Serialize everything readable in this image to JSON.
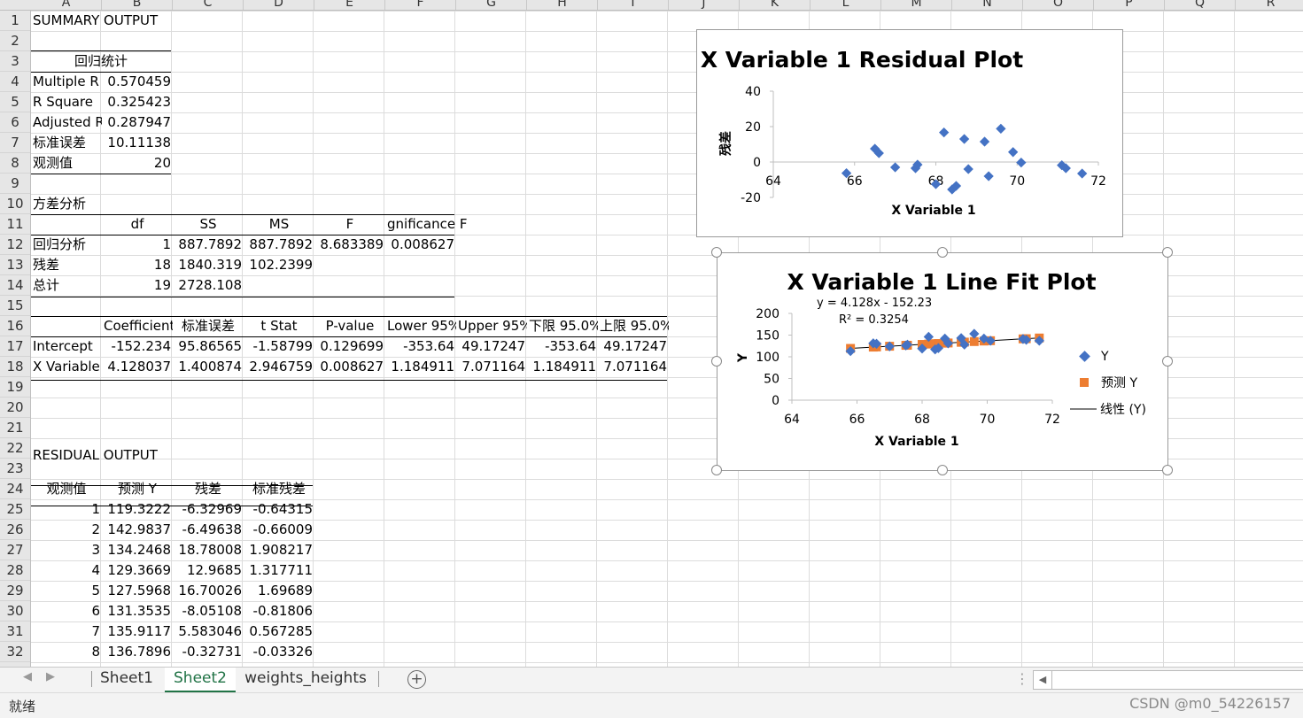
{
  "columns": [
    "A",
    "B",
    "C",
    "D",
    "E",
    "F",
    "G",
    "H",
    "I",
    "J",
    "K",
    "L",
    "M",
    "N",
    "O",
    "P",
    "Q",
    "R"
  ],
  "rows": [
    "1",
    "2",
    "3",
    "4",
    "5",
    "6",
    "7",
    "8",
    "9",
    "10",
    "11",
    "12",
    "13",
    "14",
    "15",
    "16",
    "17",
    "18",
    "19",
    "20",
    "21",
    "22",
    "23",
    "24",
    "25",
    "26",
    "27",
    "28",
    "29",
    "30",
    "31",
    "32"
  ],
  "summary": {
    "title": "SUMMARY OUTPUT",
    "regression_stats_header": "回归统计",
    "stats": [
      {
        "label": "Multiple R",
        "value": "0.570459"
      },
      {
        "label": "R Square",
        "value": "0.325423"
      },
      {
        "label": "Adjusted R",
        "value": "0.287947"
      },
      {
        "label": "标准误差",
        "value": "10.11138"
      },
      {
        "label": "观测值",
        "value": "20"
      }
    ]
  },
  "anova": {
    "title": "方差分析",
    "headers": [
      "",
      "df",
      "SS",
      "MS",
      "F",
      "gnificance F"
    ],
    "rows": [
      [
        "回归分析",
        "1",
        "887.7892",
        "887.7892",
        "8.683389",
        "0.008627"
      ],
      [
        "残差",
        "18",
        "1840.319",
        "102.2399",
        "",
        ""
      ],
      [
        "总计",
        "19",
        "2728.108",
        "",
        "",
        ""
      ]
    ]
  },
  "coef": {
    "headers": [
      "",
      "Coefficient",
      "标准误差",
      "t Stat",
      "P-value",
      "Lower 95%",
      "Upper 95%",
      "下限 95.0%",
      "上限 95.0%"
    ],
    "rows": [
      [
        "Intercept",
        "-152.234",
        "95.86565",
        "-1.58799",
        "0.129699",
        "-353.64",
        "49.17247",
        "-353.64",
        "49.17247"
      ],
      [
        "X Variable",
        "4.128037",
        "1.400874",
        "2.946759",
        "0.008627",
        "1.184911",
        "7.071164",
        "1.184911",
        "7.071164"
      ]
    ]
  },
  "residual": {
    "title": "RESIDUAL OUTPUT",
    "headers": [
      "观测值",
      "预测 Y",
      "残差",
      "标准残差"
    ],
    "rows": [
      [
        "1",
        "119.3222",
        "-6.32969",
        "-0.64315"
      ],
      [
        "2",
        "142.9837",
        "-6.49638",
        "-0.66009"
      ],
      [
        "3",
        "134.2468",
        "18.78008",
        "1.908217"
      ],
      [
        "4",
        "129.3669",
        "12.9685",
        "1.317711"
      ],
      [
        "5",
        "127.5968",
        "16.70026",
        "1.69689"
      ],
      [
        "6",
        "131.3535",
        "-8.05108",
        "-0.81806"
      ],
      [
        "7",
        "135.9117",
        "5.583046",
        "0.567285"
      ],
      [
        "8",
        "136.7896",
        "-0.32731",
        "-0.03326"
      ]
    ]
  },
  "chart_data": [
    {
      "type": "scatter",
      "title": "X Variable 1 Residual Plot",
      "xlabel": "X Variable 1",
      "ylabel": "残差",
      "xlim": [
        64,
        72
      ],
      "ylim": [
        -20,
        40
      ],
      "xticks": [
        "64",
        "66",
        "68",
        "70",
        "72"
      ],
      "yticks": [
        "-20",
        "0",
        "20",
        "40"
      ],
      "color": "#4472c4",
      "points": [
        {
          "x": 65.8,
          "y": -6.3
        },
        {
          "x": 66.5,
          "y": 7.5
        },
        {
          "x": 66.6,
          "y": 5.0
        },
        {
          "x": 67.0,
          "y": -3.0
        },
        {
          "x": 67.5,
          "y": -3.5
        },
        {
          "x": 67.55,
          "y": -1.5
        },
        {
          "x": 68.0,
          "y": -12.5
        },
        {
          "x": 68.2,
          "y": 16.7
        },
        {
          "x": 68.4,
          "y": -15.5
        },
        {
          "x": 68.5,
          "y": -13.5
        },
        {
          "x": 68.7,
          "y": 13.0
        },
        {
          "x": 68.8,
          "y": -4.0
        },
        {
          "x": 69.2,
          "y": 11.5
        },
        {
          "x": 69.3,
          "y": -8.0
        },
        {
          "x": 69.6,
          "y": 18.8
        },
        {
          "x": 69.9,
          "y": 5.6
        },
        {
          "x": 70.1,
          "y": -0.3
        },
        {
          "x": 71.1,
          "y": -1.8
        },
        {
          "x": 71.2,
          "y": -3.5
        },
        {
          "x": 71.6,
          "y": -6.5
        }
      ]
    },
    {
      "type": "scatter",
      "title": "X Variable 1 Line Fit  Plot",
      "xlabel": "X Variable 1",
      "ylabel": "Y",
      "xlim": [
        64,
        72
      ],
      "ylim": [
        0,
        200
      ],
      "xticks": [
        "64",
        "66",
        "68",
        "70",
        "72"
      ],
      "yticks": [
        "0",
        "50",
        "100",
        "150",
        "200"
      ],
      "equation": "y = 4.128x - 152.23",
      "r2": "R² = 0.3254",
      "trend": {
        "slope": 4.128037,
        "intercept": -152.234,
        "x_start": 65.8,
        "x_end": 71.6
      },
      "legend": [
        "Y",
        "预测 Y",
        "线性 (Y)"
      ],
      "colors": {
        "y": "#4472c4",
        "pred": "#ed7d31",
        "trend": "#000000"
      },
      "series_y": [
        {
          "x": 65.8,
          "y": 113
        },
        {
          "x": 66.5,
          "y": 131
        },
        {
          "x": 66.6,
          "y": 130
        },
        {
          "x": 67.0,
          "y": 124
        },
        {
          "x": 67.5,
          "y": 126
        },
        {
          "x": 67.55,
          "y": 128
        },
        {
          "x": 68.0,
          "y": 119
        },
        {
          "x": 68.2,
          "y": 146
        },
        {
          "x": 68.4,
          "y": 117
        },
        {
          "x": 68.5,
          "y": 120
        },
        {
          "x": 68.7,
          "y": 142
        },
        {
          "x": 68.8,
          "y": 131
        },
        {
          "x": 69.2,
          "y": 143
        },
        {
          "x": 69.3,
          "y": 128
        },
        {
          "x": 69.6,
          "y": 153
        },
        {
          "x": 69.9,
          "y": 142
        },
        {
          "x": 70.1,
          "y": 137
        },
        {
          "x": 71.1,
          "y": 141
        },
        {
          "x": 71.2,
          "y": 139
        },
        {
          "x": 71.6,
          "y": 137
        }
      ],
      "series_pred": [
        {
          "x": 65.8,
          "y": 119.3
        },
        {
          "x": 66.5,
          "y": 122.3
        },
        {
          "x": 66.6,
          "y": 122.7
        },
        {
          "x": 67.0,
          "y": 124.3
        },
        {
          "x": 67.5,
          "y": 126.4
        },
        {
          "x": 67.55,
          "y": 126.6
        },
        {
          "x": 68.0,
          "y": 128.5
        },
        {
          "x": 68.2,
          "y": 129.3
        },
        {
          "x": 68.4,
          "y": 130.1
        },
        {
          "x": 68.5,
          "y": 130.5
        },
        {
          "x": 68.7,
          "y": 131.4
        },
        {
          "x": 68.8,
          "y": 131.8
        },
        {
          "x": 69.2,
          "y": 133.4
        },
        {
          "x": 69.3,
          "y": 133.8
        },
        {
          "x": 69.6,
          "y": 135.1
        },
        {
          "x": 69.9,
          "y": 136.3
        },
        {
          "x": 70.1,
          "y": 137.1
        },
        {
          "x": 71.1,
          "y": 141.3
        },
        {
          "x": 71.2,
          "y": 141.7
        },
        {
          "x": 71.6,
          "y": 143.3
        }
      ]
    }
  ],
  "tabs": [
    {
      "label": "Sheet1",
      "active": false
    },
    {
      "label": "Sheet2",
      "active": true
    },
    {
      "label": "weights_heights",
      "active": false
    }
  ],
  "status": {
    "ready": "就绪",
    "watermark": "CSDN @m0_54226157"
  }
}
